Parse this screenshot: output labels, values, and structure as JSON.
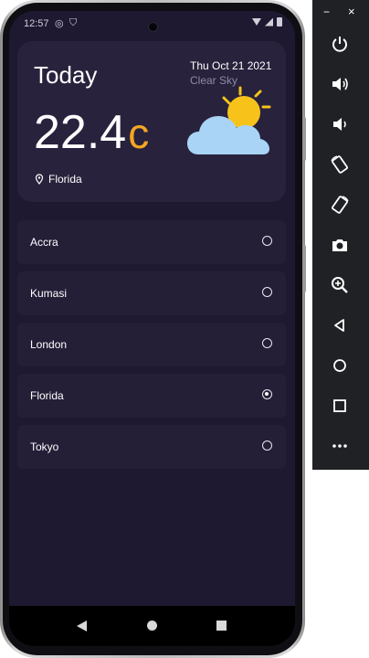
{
  "status_bar": {
    "time": "12:57"
  },
  "weather": {
    "heading": "Today",
    "date": "Thu Oct 21 2021",
    "condition": "Clear Sky",
    "temperature": "22.4",
    "unit": "c",
    "location": "Florida",
    "icon": "partly-cloudy-icon"
  },
  "cities": [
    {
      "name": "Accra",
      "selected": false
    },
    {
      "name": "Kumasi",
      "selected": false
    },
    {
      "name": "London",
      "selected": false
    },
    {
      "name": "Florida",
      "selected": true
    },
    {
      "name": "Tokyo",
      "selected": false
    }
  ],
  "emulator_toolbar": {
    "minimize": "−",
    "close": "×",
    "buttons": [
      "power-icon",
      "volume-up-icon",
      "volume-down-icon",
      "rotate-left-icon",
      "rotate-right-icon",
      "camera-icon",
      "zoom-icon",
      "back-icon",
      "home-icon",
      "overview-icon",
      "more-icon"
    ]
  },
  "colors": {
    "background": "#1e1831",
    "card": "#28223d",
    "accent": "#f5a623",
    "cloud": "#a9d4f5",
    "sun": "#f7c31b"
  }
}
